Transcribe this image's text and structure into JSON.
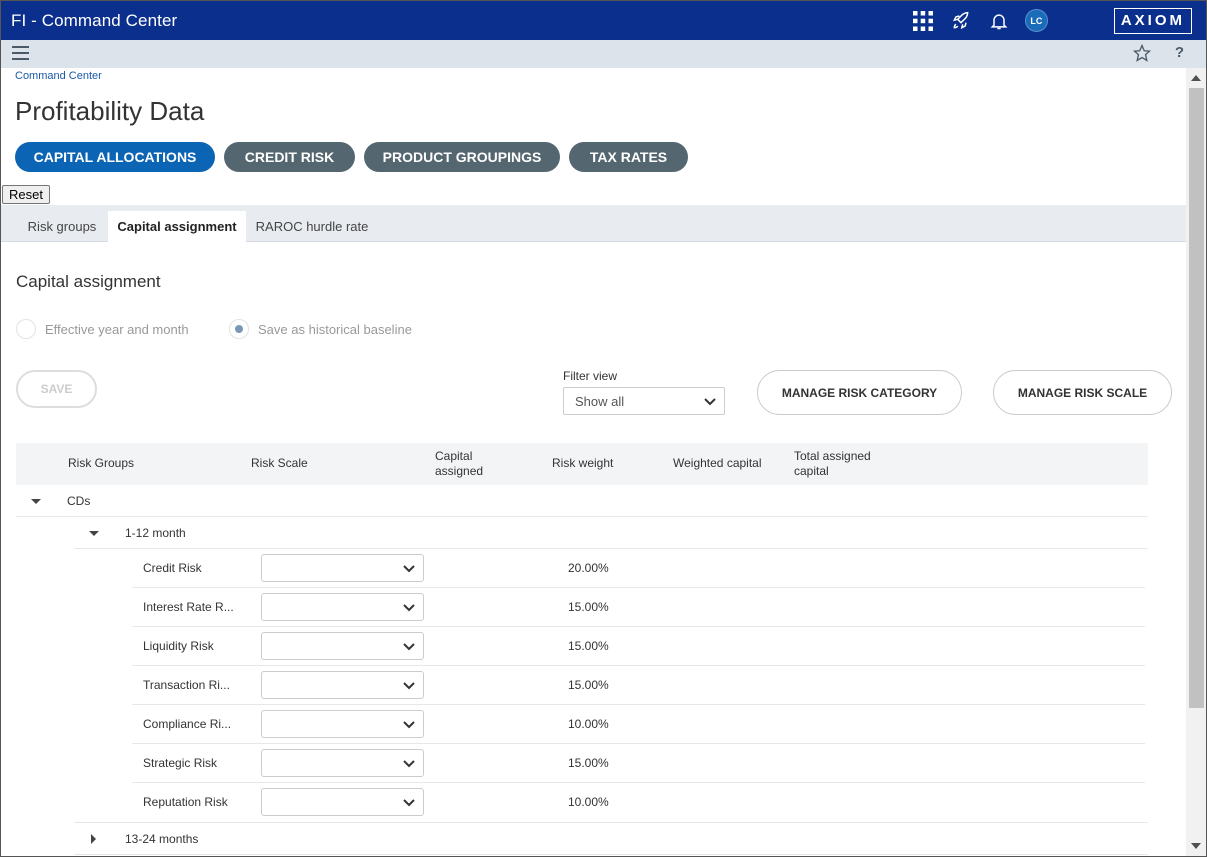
{
  "app": {
    "title": "FI - Command Center",
    "logo_text": "AXIOM",
    "user_initials": "LC"
  },
  "breadcrumb": "Command Center",
  "page_title": "Profitability Data",
  "pill_tabs": [
    {
      "label": "CAPITAL ALLOCATIONS",
      "active": true
    },
    {
      "label": "CREDIT RISK",
      "active": false
    },
    {
      "label": "PRODUCT GROUPINGS",
      "active": false
    },
    {
      "label": "TAX RATES",
      "active": false
    }
  ],
  "reset_label": "Reset",
  "tabs": [
    {
      "label": "Risk groups",
      "active": false
    },
    {
      "label": "Capital assignment",
      "active": true
    },
    {
      "label": "RAROC hurdle rate",
      "active": false
    }
  ],
  "section_title": "Capital assignment",
  "radios": [
    {
      "label": "Effective year and month",
      "selected": false
    },
    {
      "label": "Save as historical baseline",
      "selected": true
    }
  ],
  "save_label": "SAVE",
  "filter": {
    "label": "Filter view",
    "value": "Show all"
  },
  "manage_risk_category_label": "MANAGE RISK CATEGORY",
  "manage_risk_scale_label": "MANAGE RISK SCALE",
  "table": {
    "headers": {
      "risk_groups": "Risk Groups",
      "risk_scale": "Risk Scale",
      "capital_assigned_1": "Capital",
      "capital_assigned_2": "assigned",
      "risk_weight": "Risk weight",
      "weighted_capital": "Weighted capital",
      "total_assigned_1": "Total assigned",
      "total_assigned_2": "capital"
    },
    "group": "CDs",
    "subgroup": "1-12 month",
    "rows": [
      {
        "name": "Credit Risk",
        "weight": "20.00%"
      },
      {
        "name": "Interest Rate R...",
        "weight": "15.00%"
      },
      {
        "name": "Liquidity Risk",
        "weight": "15.00%"
      },
      {
        "name": "Transaction Ri...",
        "weight": "15.00%"
      },
      {
        "name": "Compliance Ri...",
        "weight": "10.00%"
      },
      {
        "name": "Strategic Risk",
        "weight": "15.00%"
      },
      {
        "name": "Reputation Risk",
        "weight": "10.00%"
      }
    ],
    "next_subgroup": "13-24 months"
  }
}
